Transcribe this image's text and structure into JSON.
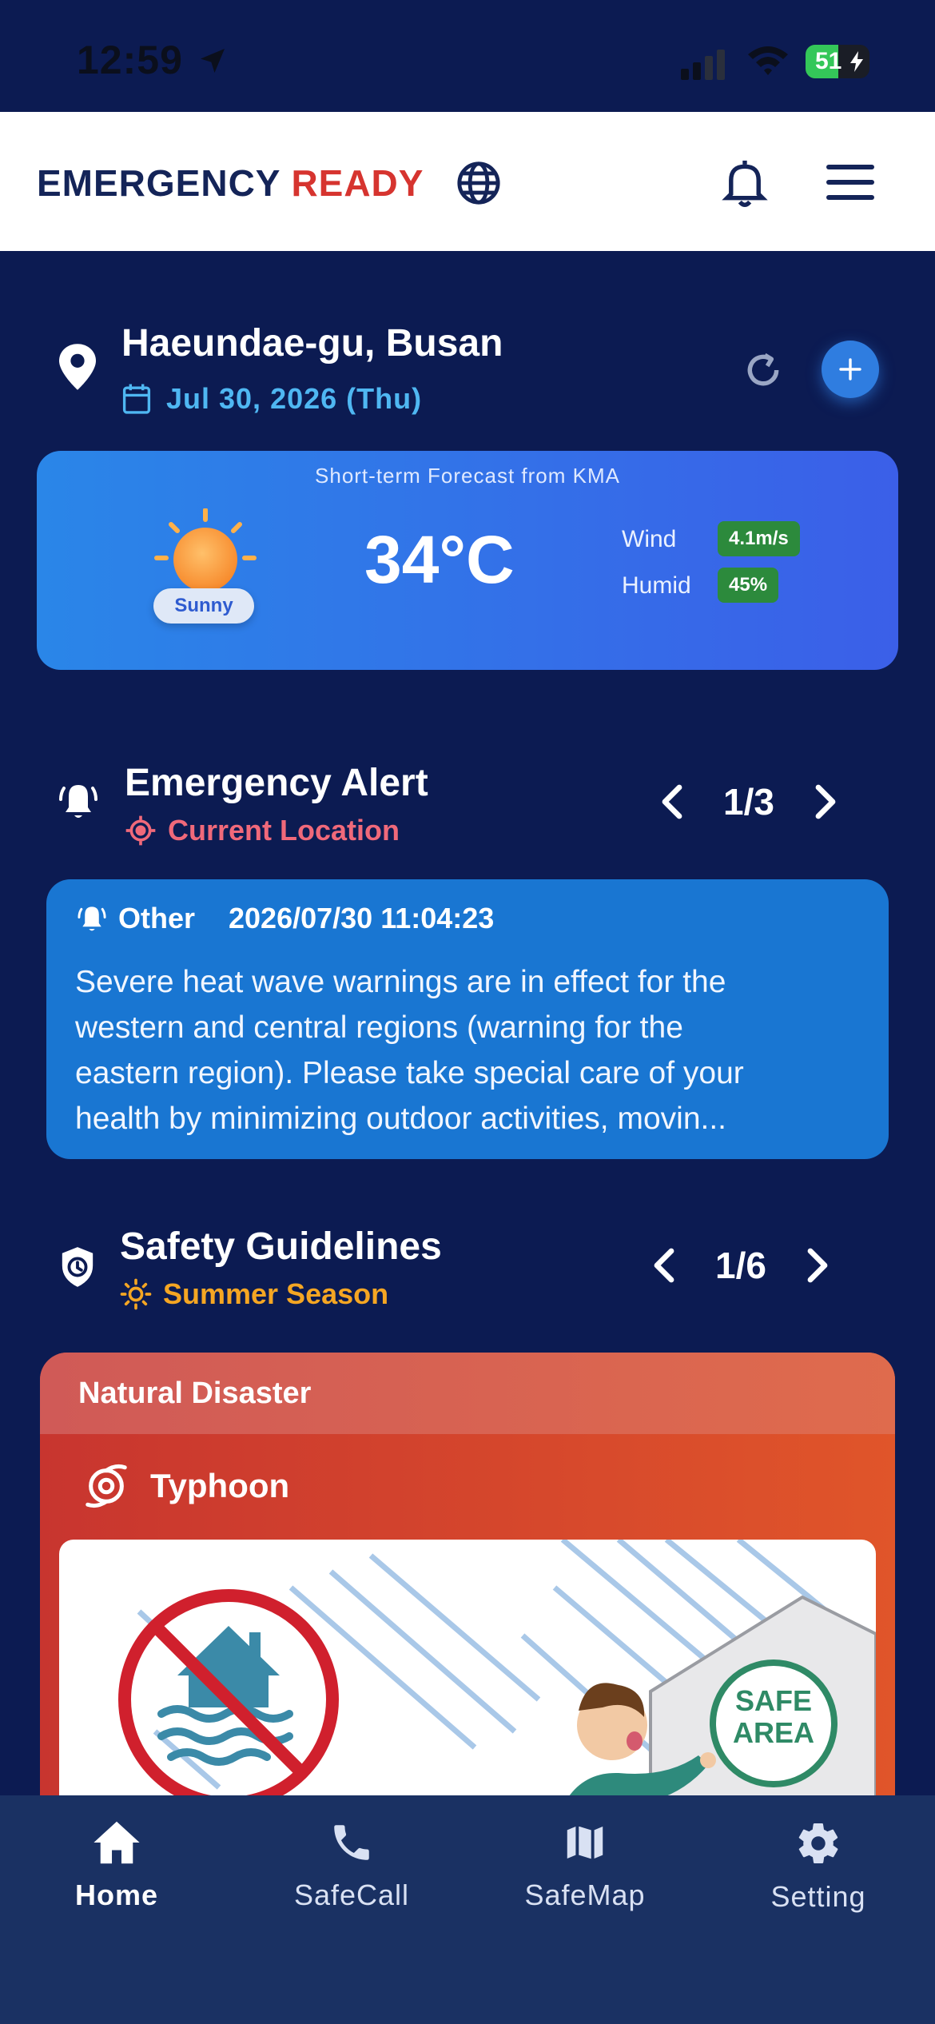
{
  "status_bar": {
    "time": "12:59",
    "battery": "51"
  },
  "header": {
    "brand_primary": "EMERGENCY",
    "brand_accent": "READY"
  },
  "location": {
    "title": "Haeundae-gu, Busan",
    "date": "Jul 30, 2026 (Thu)"
  },
  "weather": {
    "source": "Short-term Forecast from KMA",
    "condition": "Sunny",
    "temperature": "34°C",
    "wind_label": "Wind",
    "wind_value": "4.1m/s",
    "humid_label": "Humid",
    "humid_value": "45%"
  },
  "alert": {
    "title": "Emergency Alert",
    "subtitle": "Current Location",
    "page": "1/3",
    "card": {
      "category": "Other",
      "timestamp": "2026/07/30 11:04:23",
      "body": "Severe heat wave warnings are in effect for the\nwestern and central regions (warning for the\neastern region). Please take special care of your\nhealth by minimizing outdoor activities, movin..."
    }
  },
  "guidelines": {
    "title": "Safety Guidelines",
    "subtitle": "Summer Season",
    "page": "1/6",
    "card": {
      "category": "Natural Disaster",
      "type": "Typhoon",
      "image_sign_text": "SAFE AREA"
    }
  },
  "nav": [
    {
      "label": "Home",
      "icon": "home-icon"
    },
    {
      "label": "SafeCall",
      "icon": "phone-icon"
    },
    {
      "label": "SafeMap",
      "icon": "map-icon"
    },
    {
      "label": "Setting",
      "icon": "gear-icon"
    }
  ],
  "colors": {
    "background": "#0c1b52",
    "brand_red": "#d6342f",
    "date_blue": "#4fb7f2",
    "alert_card": "#1976d2",
    "alert_pink": "#f0697a",
    "season_orange": "#f5a623",
    "badge_green": "#2c8a3c"
  }
}
